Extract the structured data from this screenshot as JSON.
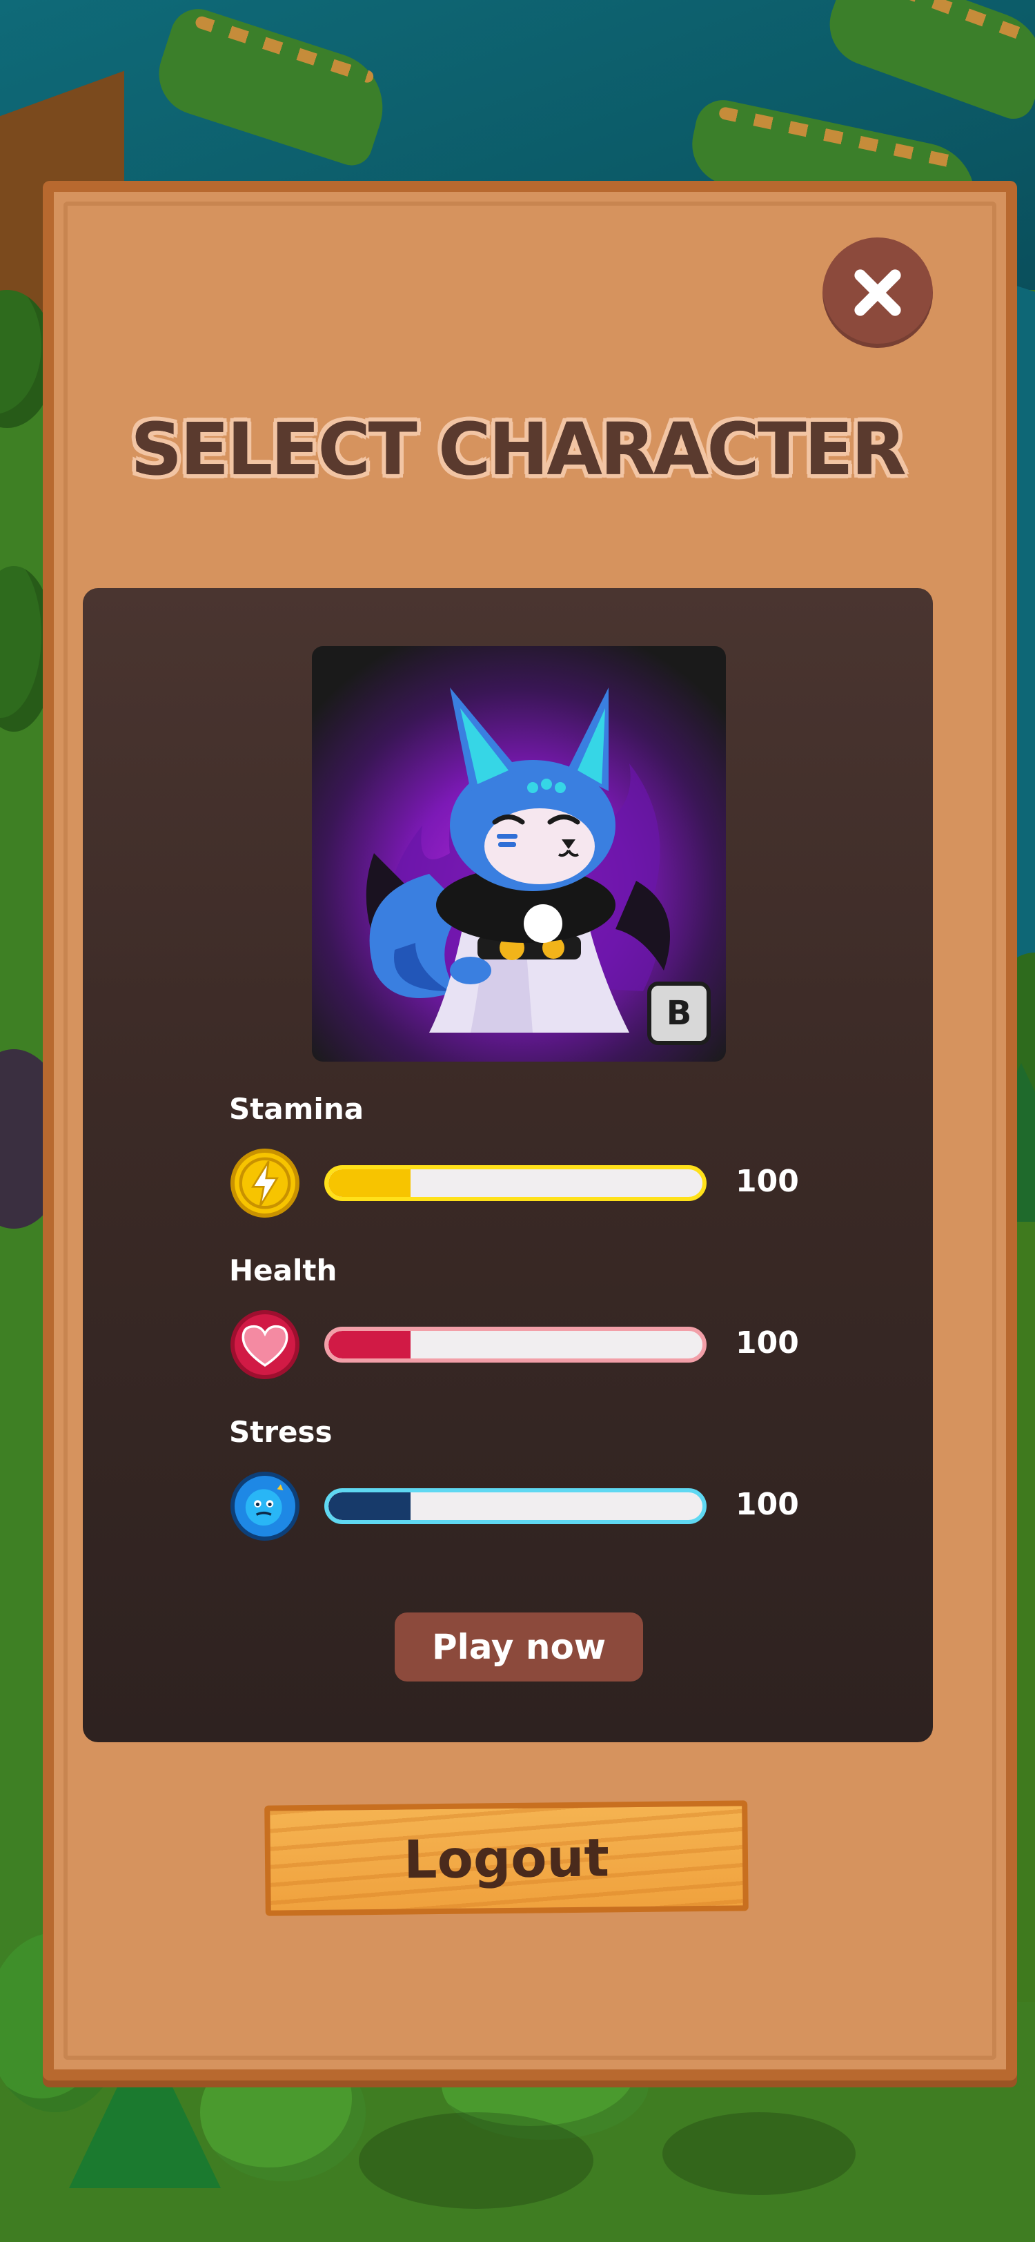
{
  "title": "SELECT CHARACTER",
  "close_icon": "close-icon",
  "character": {
    "rank": "B",
    "portrait": "blue-fox-character"
  },
  "stats": [
    {
      "label": "Stamina",
      "value": "100",
      "fill_fraction": 0.22,
      "icon": "lightning-icon",
      "fill_color": "#f7c400",
      "border_color": "#ffe11a"
    },
    {
      "label": "Health",
      "value": "100",
      "fill_fraction": 0.22,
      "icon": "heart-icon",
      "fill_color": "#d11a45",
      "border_color": "#f29fa8"
    },
    {
      "label": "Stress",
      "value": "100",
      "fill_fraction": 0.22,
      "icon": "stress-face-icon",
      "fill_color": "#173a6a",
      "border_color": "#5fd8f2"
    }
  ],
  "buttons": {
    "play": "Play now",
    "logout": "Logout"
  },
  "colors": {
    "parchment": "#d6935e",
    "card": "#3b2a26",
    "accent_button": "#8c4a3c"
  }
}
